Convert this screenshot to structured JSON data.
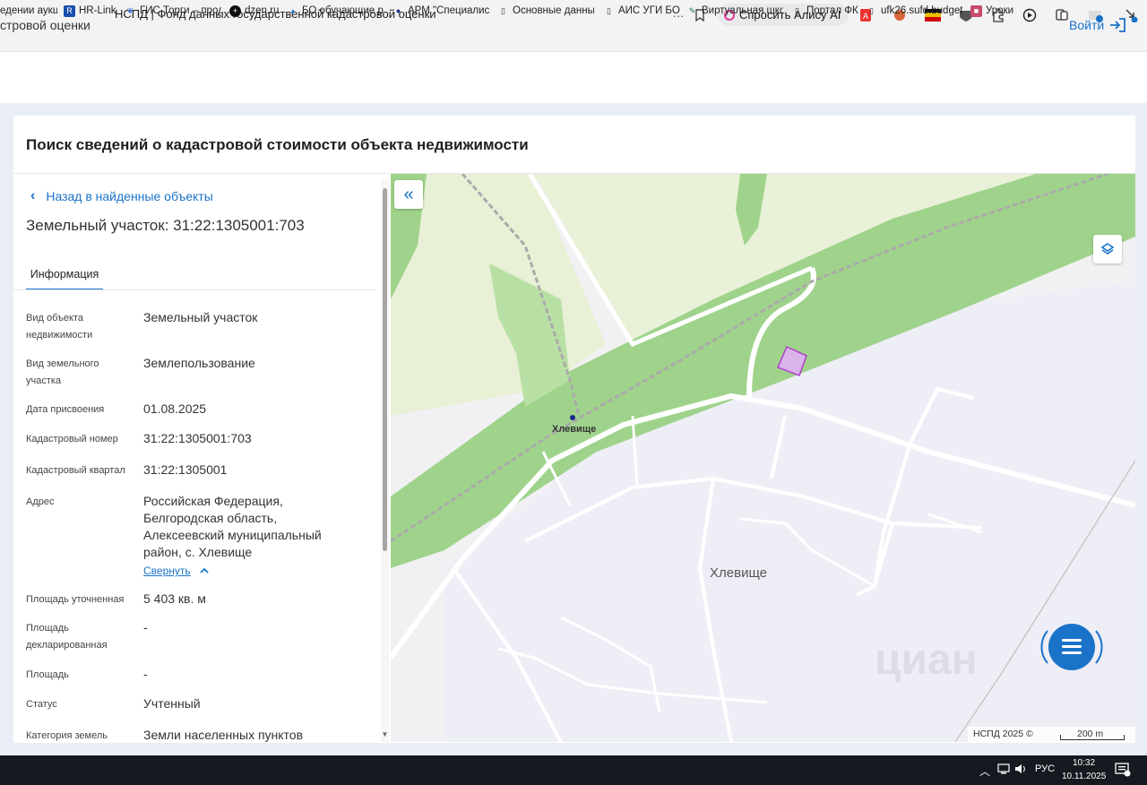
{
  "browser": {
    "tab_title": "НСПД | Фонд данных государственной кадастровой оценки",
    "alice_label": "Спросить Алису AI",
    "bookmarks": [
      {
        "label": "едении аукц",
        "icon": "doc-icon"
      },
      {
        "label": "HR-Link",
        "icon": "hr-link-icon"
      },
      {
        "label": "ГИС Торги – прод",
        "icon": "gis-torgi-icon"
      },
      {
        "label": "dzen.ru",
        "icon": "dzen-icon"
      },
      {
        "label": "БО обучающие ре",
        "icon": "bo-icon"
      },
      {
        "label": "АРМ \"Специалист",
        "icon": "arm-icon"
      },
      {
        "label": "Основные данные",
        "icon": "doc-icon"
      },
      {
        "label": "АИС УГИ БО",
        "icon": "doc-icon"
      },
      {
        "label": "Виртуальная шко",
        "icon": "virtual-school-icon"
      },
      {
        "label": "Портал ФК",
        "icon": "doc-icon"
      },
      {
        "label": "ufk26.sufd.budget",
        "icon": "doc-icon"
      },
      {
        "label": "Уроки",
        "icon": "lessons-icon"
      }
    ]
  },
  "site": {
    "title": "стровой оценки",
    "login_label": "Войти"
  },
  "page": {
    "heading": "Поиск сведений о кадастровой стоимости объекта недвижимости",
    "back_label": "Назад в найденные объекты",
    "object_title": "Земельный участок: 31:22:1305001:703",
    "tab_label": "Информация",
    "collapse_label": "Свернуть",
    "fields": [
      {
        "label": "Вид объекта недвижимости",
        "value": "Земельный участок"
      },
      {
        "label": "Вид земельного участка",
        "value": "Землепользование"
      },
      {
        "label": "Дата присвоения",
        "value": "01.08.2025"
      },
      {
        "label": "Кадастровый номер",
        "value": "31:22:1305001:703"
      },
      {
        "label": "Кадастровый квартал",
        "value": "31:22:1305001"
      },
      {
        "label": "Адрес",
        "value": "Российская Федерация, Белгородская область, Алексеевский муниципальный район, с. Хлевище"
      },
      {
        "label": "Площадь уточненная",
        "value": "5 403 кв. м"
      },
      {
        "label": "Площадь декларированная",
        "value": "-"
      },
      {
        "label": "Площадь",
        "value": "-"
      },
      {
        "label": "Статус",
        "value": "Учтенный"
      },
      {
        "label": "Категория земель",
        "value": "Земли населенных пунктов"
      }
    ]
  },
  "map": {
    "village_label_small": "Хлевище",
    "village_label": "Хлевище",
    "watermark": "циан",
    "attribution": "НСПД 2025 ©",
    "scale_label": "200 m",
    "colors": {
      "forest": "#98d084",
      "field": "#e9f1d8",
      "settlement": "#eeeef6",
      "parcel_fill": "#d9b3ea",
      "parcel_stroke": "#b13fc9"
    }
  },
  "taskbar": {
    "lang": "РУС",
    "time": "10:32",
    "date": "10.11.2025"
  }
}
